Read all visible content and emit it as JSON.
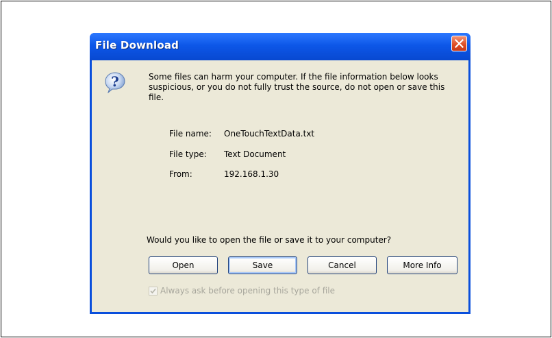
{
  "dialog": {
    "title": "File Download",
    "warning_text": "Some files can harm your computer. If the file information below looks suspicious, or you do not fully trust the source, do not open or save this file.",
    "file_info": {
      "name_label": "File name:",
      "name_value": "OneTouchTextData.txt",
      "type_label": "File type:",
      "type_value": "Text Document",
      "from_label": "From:",
      "from_value": "192.168.1.30"
    },
    "question": "Would you like to open the file or save it to your computer?",
    "buttons": {
      "open": "Open",
      "save": "Save",
      "cancel": "Cancel",
      "more_info": "More Info"
    },
    "checkbox": {
      "label": "Always ask before opening this type of file",
      "checked": true,
      "disabled": true
    }
  },
  "icons": {
    "close": "close-icon",
    "question": "question-icon",
    "check": "checkmark-icon"
  },
  "colors": {
    "titlebar": "#0d57e8",
    "body": "#ece9d8",
    "close_button": "#de4b22",
    "disabled_text": "#a7a69c"
  }
}
